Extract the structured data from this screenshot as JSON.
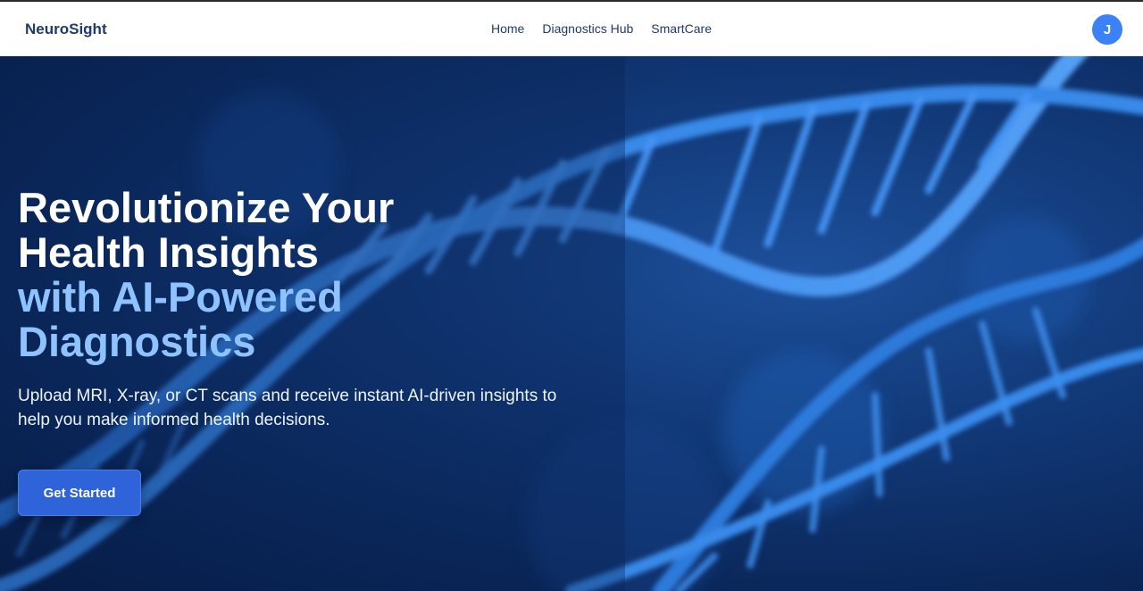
{
  "header": {
    "brand": "NeuroSight",
    "nav": [
      {
        "label": "Home"
      },
      {
        "label": "Diagnostics Hub"
      },
      {
        "label": "SmartCare"
      }
    ],
    "avatar_initial": "J"
  },
  "hero": {
    "headline_line1": "Revolutionize Your",
    "headline_line2": "Health Insights",
    "accent_line1": "with AI-Powered",
    "accent_line2": "Diagnostics",
    "subtext": "Upload MRI, X-ray, or CT scans and receive instant AI-driven insights to help you make informed health decisions.",
    "cta_label": "Get Started",
    "background_image": "dna-helix-image"
  },
  "colors": {
    "brand_text": "#1e3a6e",
    "accent_text": "#8ec3ff",
    "button": "#2f63d9",
    "avatar": "#3b82f6",
    "hero_bg": "#0b2a5e"
  }
}
